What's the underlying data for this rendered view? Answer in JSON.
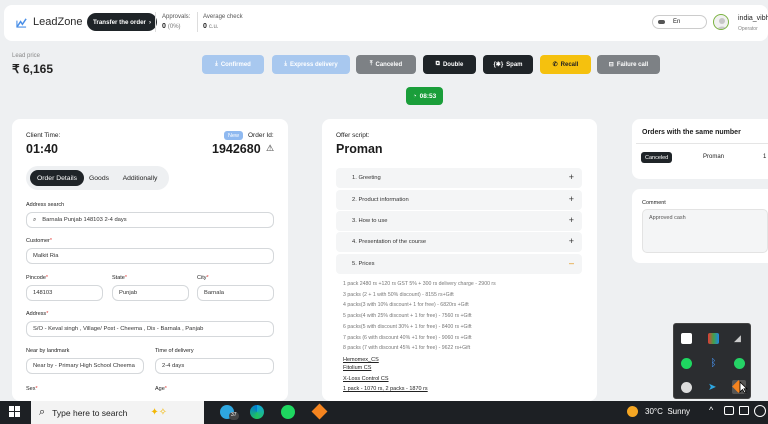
{
  "header": {
    "logo": "LeadZone",
    "transfer_button": "Transfer the order",
    "approvals_label": "Approvals:",
    "approvals_value": "0",
    "approvals_pct": "(0%)",
    "average_check_label": "Average check",
    "average_check_value": "0",
    "average_check_unit": "c.u.",
    "language": "En",
    "user_name": "india_vibh",
    "user_role": "Operator"
  },
  "lead": {
    "label": "Lead price",
    "value": "₹ 6,165"
  },
  "actions": {
    "confirmed": "Confirmed",
    "express_delivery": "Express delivery",
    "canceled": "Canceled",
    "double": "Double",
    "spam": "Spam",
    "recall": "Recall",
    "failure_call": "Failure call",
    "timer": "08:53"
  },
  "order": {
    "client_time_label": "Client Time:",
    "client_time": "01:40",
    "new_badge": "New",
    "order_id_label": "Order Id:",
    "order_id": "1942680",
    "tabs": [
      "Order Details",
      "Goods",
      "Additionally"
    ],
    "address_search_label": "Address search",
    "address_search_value": "Barnala Punjab 148103 2-4 days",
    "customer_label": "Customer",
    "customer_value": "Malkit Ria",
    "pincode_label": "Pincode",
    "pincode_value": "148103",
    "state_label": "State",
    "state_value": "Punjab",
    "city_label": "City",
    "city_value": "Barnala",
    "address_label": "Address",
    "address_value": "S/O - Keval singh , Village/ Post - Cheema , Dis - Barnala , Panjab",
    "landmark_label": "Near by landmark",
    "landmark_value": "Near by - Primary High School Cheema",
    "delivery_label": "Time of delivery",
    "delivery_value": "2-4 days",
    "sex_label": "Sex",
    "age_label": "Age",
    "required_mark": "*"
  },
  "script": {
    "label": "Offer script:",
    "title": "Proman",
    "sections": [
      "1. Greeting",
      "2. Product information",
      "3. How to use",
      "4. Presentation of the course",
      "5. Prices"
    ],
    "prices": [
      "1 pack 2480 rs +120 rs GST 5% + 300 rs delivery charge - 2900 rs",
      "3 packs (2 + 1 with 50% discount) - 8155 rs+Gift",
      "4 packs(3 with 10% discount+ 1 for free) - 6820rs +Gift",
      "5 packs(4 with 25% discount + 1 for free) - 7560 rs +Gift",
      "6 packs(5 with discount 30% + 1 for free) - 8400 rs +Gift",
      "7 packs (6 with discount 40% +1 for free) - 9060 rs +Gift",
      "8 packs (7 with discount 45% +1 for free) - 9622 rs+Gift"
    ],
    "links": [
      "Hemomex_CS",
      "Fitolium CS",
      "X-Loss Control CS",
      "1 pack - 1070 rs, 2 packs - 1870 rs"
    ]
  },
  "same_orders": {
    "title": "Orders with the same number",
    "status": "Canceled",
    "product": "Proman",
    "id_partial": "1"
  },
  "comment": {
    "label": "Comment",
    "value": "Approved cash"
  },
  "taskbar": {
    "search_placeholder": "Type here to search",
    "badge_count": "37",
    "temperature": "30°C",
    "weather": "Sunny"
  },
  "colors": {
    "confirmed": "#a8c8ef",
    "canceled": "#7d8185",
    "dark": "#1f2428",
    "recall": "#f5c10e",
    "timer": "#1a9e3a",
    "new_badge": "#8fb9f0"
  }
}
